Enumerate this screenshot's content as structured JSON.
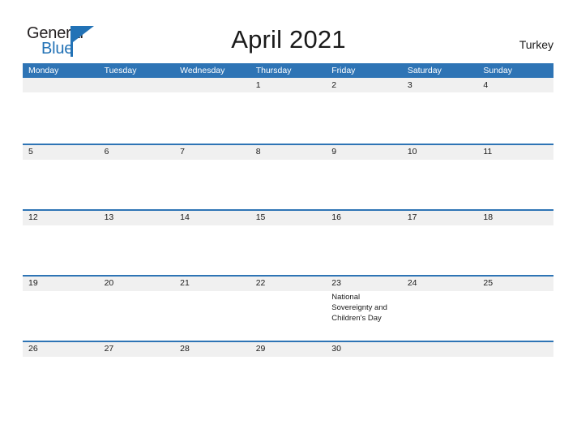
{
  "brand": {
    "name_part1": "General",
    "name_part2": "Blue",
    "triangle_color": "#2272b6",
    "text_color": "#231f20"
  },
  "header": {
    "title": "April 2021",
    "region": "Turkey",
    "accent_color": "#2e74b5",
    "band_color": "#f0f0f0"
  },
  "calendar": {
    "weekdays": [
      "Monday",
      "Tuesday",
      "Wednesday",
      "Thursday",
      "Friday",
      "Saturday",
      "Sunday"
    ],
    "weeks": [
      [
        {
          "day": ""
        },
        {
          "day": ""
        },
        {
          "day": ""
        },
        {
          "day": "1"
        },
        {
          "day": "2"
        },
        {
          "day": "3"
        },
        {
          "day": "4"
        }
      ],
      [
        {
          "day": "5"
        },
        {
          "day": "6"
        },
        {
          "day": "7"
        },
        {
          "day": "8"
        },
        {
          "day": "9"
        },
        {
          "day": "10"
        },
        {
          "day": "11"
        }
      ],
      [
        {
          "day": "12"
        },
        {
          "day": "13"
        },
        {
          "day": "14"
        },
        {
          "day": "15"
        },
        {
          "day": "16"
        },
        {
          "day": "17"
        },
        {
          "day": "18"
        }
      ],
      [
        {
          "day": "19"
        },
        {
          "day": "20"
        },
        {
          "day": "21"
        },
        {
          "day": "22"
        },
        {
          "day": "23",
          "event": "National Sovereignty and Children's Day"
        },
        {
          "day": "24"
        },
        {
          "day": "25"
        }
      ],
      [
        {
          "day": "26"
        },
        {
          "day": "27"
        },
        {
          "day": "28"
        },
        {
          "day": "29"
        },
        {
          "day": "30"
        },
        {
          "day": ""
        },
        {
          "day": ""
        }
      ]
    ]
  }
}
